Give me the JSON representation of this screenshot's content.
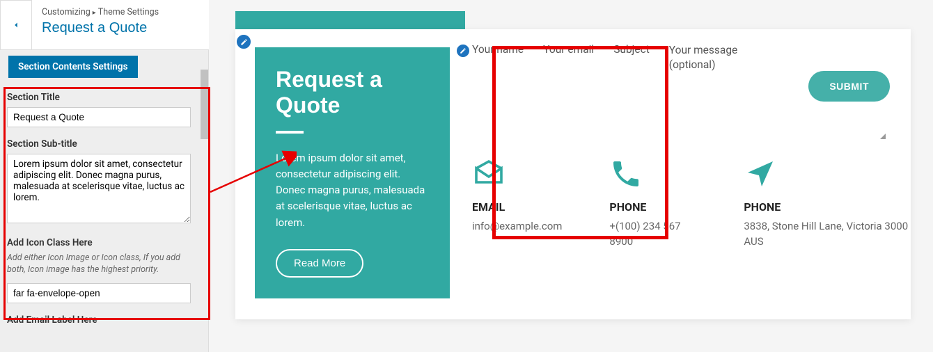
{
  "breadcrumb": {
    "root": "Customizing",
    "parent": "Theme Settings",
    "title": "Request a Quote"
  },
  "section_button": "Section Contents Settings",
  "fields": {
    "title_label": "Section Title",
    "title_value": "Request a Quote",
    "subtitle_label": "Section Sub-title",
    "subtitle_value": "Lorem ipsum dolor sit amet, consectetur adipiscing elit. Donec magna purus, malesuada at scelerisque vitae, luctus ac lorem.",
    "icon_label": "Add Icon Class Here",
    "icon_desc": "Add either Icon Image or Icon class, If you add both, Icon image has the highest priority.",
    "icon_value": "far fa-envelope-open",
    "email_label_label": "Add Email Label Here"
  },
  "preview": {
    "quote_title": "Request a Quote",
    "quote_sub": "Lorem ipsum dolor sit amet, consectetur adipiscing elit. Donec magna purus, malesuada at scelerisque vitae, luctus ac lorem.",
    "read_more": "Read More",
    "form": {
      "name": "Your name",
      "email": "Your email",
      "subject": "Subject",
      "message": "Your message (optional)",
      "submit": "SUBMIT"
    },
    "contacts": [
      {
        "icon": "envelope",
        "label": "EMAIL",
        "value": "info@example.com"
      },
      {
        "icon": "phone",
        "label": "PHONE",
        "value": "+(100) 234 567 8900"
      },
      {
        "icon": "location",
        "label": "PHONE",
        "value": "3838, Stone Hill Lane, Victoria 3000 AUS"
      }
    ]
  }
}
